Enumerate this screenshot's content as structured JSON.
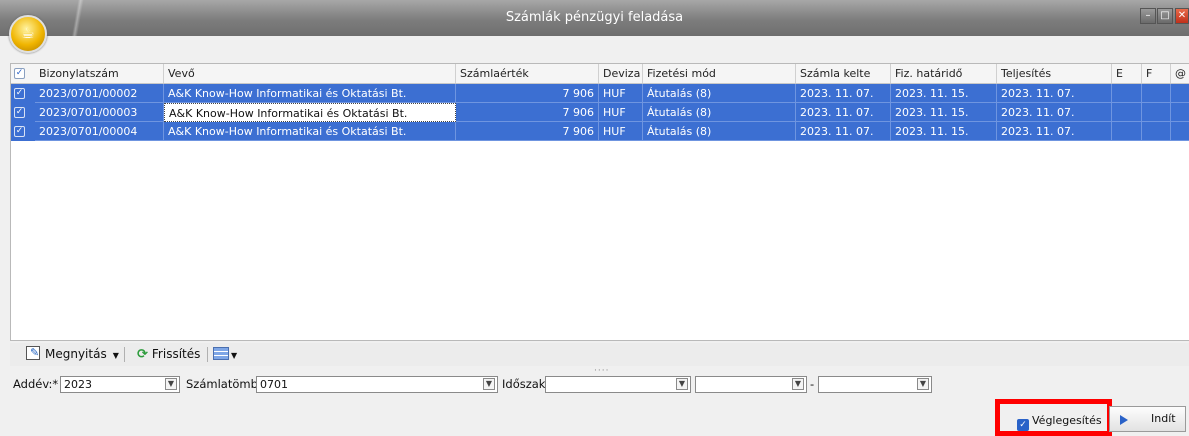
{
  "window": {
    "title": "Számlák pénzügyi feladása",
    "controls": [
      "minimize",
      "maximize",
      "close"
    ]
  },
  "table": {
    "columns": [
      "Bizonylatszám",
      "Vevő",
      "Számlaérték",
      "Deviza",
      "Fizetési mód",
      "Számla kelte",
      "Fiz. határidő",
      "Teljesítés",
      "E",
      "F",
      "@"
    ],
    "rows": [
      {
        "checked": true,
        "cells": [
          "2023/0701/00002",
          "A&K Know-How Informatikai és Oktatási Bt.",
          "7 906",
          "HUF",
          "Átutalás (8)",
          "2023. 11. 07.",
          "2023. 11. 15.",
          "2023. 11. 07.",
          "",
          "",
          ""
        ]
      },
      {
        "checked": true,
        "cells": [
          "2023/0701/00003",
          "A&K Know-How Informatikai és Oktatási Bt.",
          "7 906",
          "HUF",
          "Átutalás (8)",
          "2023. 11. 07.",
          "2023. 11. 15.",
          "2023. 11. 07.",
          "",
          "",
          ""
        ]
      },
      {
        "checked": true,
        "cells": [
          "2023/0701/00004",
          "A&K Know-How Informatikai és Oktatási Bt.",
          "7 906",
          "HUF",
          "Átutalás (8)",
          "2023. 11. 07.",
          "2023. 11. 15.",
          "2023. 11. 07.",
          "",
          "",
          ""
        ]
      }
    ],
    "focused_cell": {
      "row": 1,
      "column": 1
    }
  },
  "toolbar": {
    "open_label": "Megnyitás",
    "refresh_label": "Frissítés"
  },
  "filters": {
    "year_label": "Addév:*",
    "year_value": "2023",
    "block_label": "Számlatömb:*",
    "block_value": "0701",
    "period_label": "Időszak:",
    "period_from": "",
    "period_from2": "",
    "period_separator": "-",
    "period_to": ""
  },
  "actions": {
    "finalize_label": "Véglegesítés",
    "finalize_checked": true,
    "start_label": "Indít"
  },
  "colors": {
    "selection": "#3c6fd2",
    "highlight_box": "#ff0000",
    "titlebar": "#7d7d7d"
  },
  "icons": [
    "app-orb-icon",
    "minimize-icon",
    "maximize-icon",
    "close-icon",
    "open-icon",
    "refresh-icon",
    "grid-layout-icon",
    "play-icon"
  ]
}
